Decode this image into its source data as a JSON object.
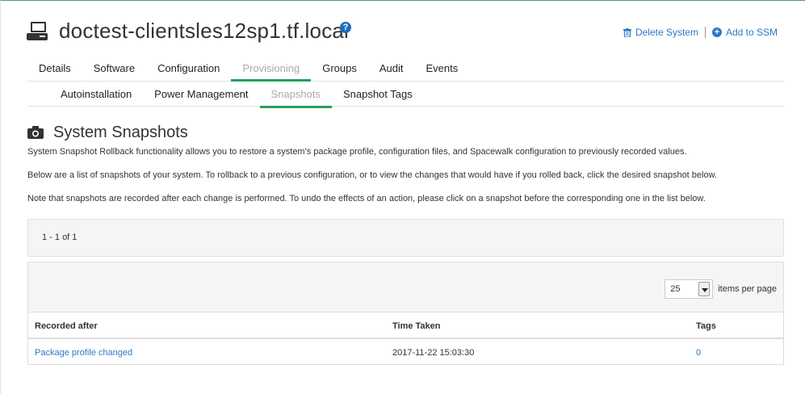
{
  "header": {
    "title": "doctest-clientsles12sp1.tf.local",
    "help_glyph": "?",
    "delete_label": "Delete System",
    "add_ssm_label": "Add to SSM",
    "icons": {
      "system": "system-desktop-icon",
      "help": "question-circle-icon",
      "delete": "trash-icon",
      "add": "plus-circle-icon"
    },
    "accent_color": "#2a79c9"
  },
  "tabs_primary": [
    {
      "label": "Details",
      "active": false
    },
    {
      "label": "Software",
      "active": false
    },
    {
      "label": "Configuration",
      "active": false
    },
    {
      "label": "Provisioning",
      "active": true
    },
    {
      "label": "Groups",
      "active": false
    },
    {
      "label": "Audit",
      "active": false
    },
    {
      "label": "Events",
      "active": false
    }
  ],
  "tabs_secondary": [
    {
      "label": "Autoinstallation",
      "active": false
    },
    {
      "label": "Power Management",
      "active": false
    },
    {
      "label": "Snapshots",
      "active": true
    },
    {
      "label": "Snapshot Tags",
      "active": false
    }
  ],
  "active_tab_color": "#23a05b",
  "section": {
    "title": "System Snapshots",
    "icon": "camera-icon",
    "paragraphs": [
      "System Snapshot Rollback functionality allows you to restore a system's package profile, configuration files, and Spacewalk configuration to previously recorded values.",
      "Below are a list of snapshots of your system. To rollback to a previous configuration, or to view the changes that would have if you rolled back, click the desired snapshot below.",
      "Note that snapshots are recorded after each change is performed. To undo the effects of an action, please click on a snapshot before the corresponding one in the list below."
    ]
  },
  "pager": {
    "text": "1 - 1 of 1"
  },
  "table": {
    "items_per_page_value": "25",
    "items_per_page_label": "items per page",
    "columns": [
      "Recorded after",
      "Time Taken",
      "Tags"
    ],
    "rows": [
      {
        "recorded_after": "Package profile changed",
        "time_taken": "2017-11-22 15:03:30",
        "tags": "0"
      }
    ]
  }
}
